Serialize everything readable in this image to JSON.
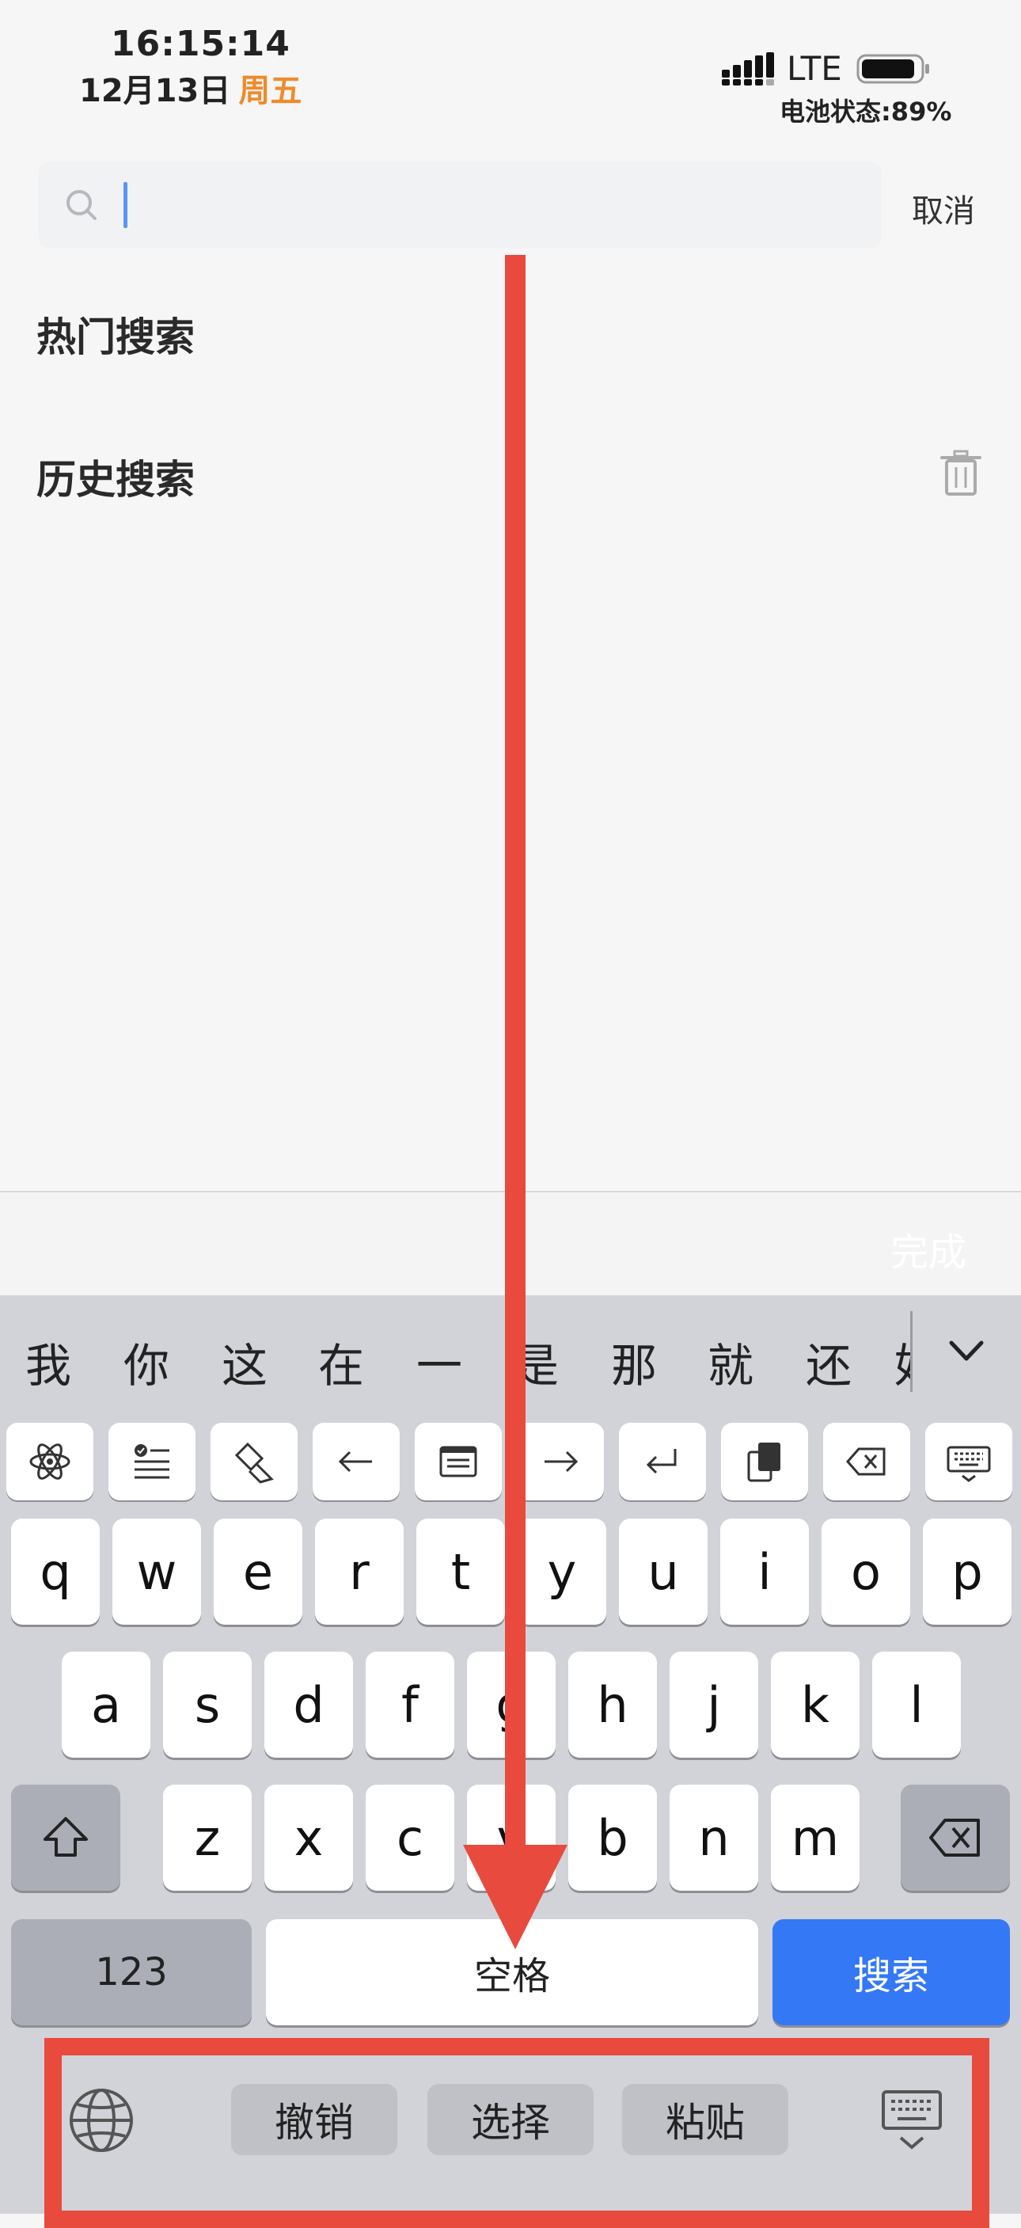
{
  "status_bar": {
    "time": "16:15:14",
    "date": "12月13日",
    "weekday": "周五",
    "network": "LTE",
    "battery": "电池状态:89%"
  },
  "search": {
    "cancel_label": "取消"
  },
  "sections": {
    "hot": "热门搜索",
    "history": "历史搜索"
  },
  "accessory": {
    "done_label": "完成"
  },
  "keyboard": {
    "candidates": [
      "我",
      "你",
      "这",
      "在",
      "一",
      "是",
      "那",
      "就",
      "还",
      "好"
    ],
    "toolbar_icons": [
      "atom-icon",
      "checklist-icon",
      "edit-cursor-icon",
      "arrow-left-icon",
      "window-icon",
      "arrow-right-icon",
      "return-icon",
      "clipboard-icon",
      "backspace-icon",
      "keyboard-icon"
    ],
    "row1": [
      "q",
      "w",
      "e",
      "r",
      "t",
      "y",
      "u",
      "i",
      "o",
      "p"
    ],
    "row2": [
      "a",
      "s",
      "d",
      "f",
      "g",
      "h",
      "j",
      "k",
      "l"
    ],
    "row3": [
      "z",
      "x",
      "c",
      "v",
      "b",
      "n",
      "m"
    ],
    "numbers_label": "123",
    "space_label": "空格",
    "search_label": "搜索",
    "bottom_actions": [
      "撤销",
      "选择",
      "粘贴"
    ]
  },
  "colors": {
    "accent_blue": "#3478f6",
    "weekday_orange": "#f08a2b",
    "annotation_red": "#e84a3d"
  }
}
